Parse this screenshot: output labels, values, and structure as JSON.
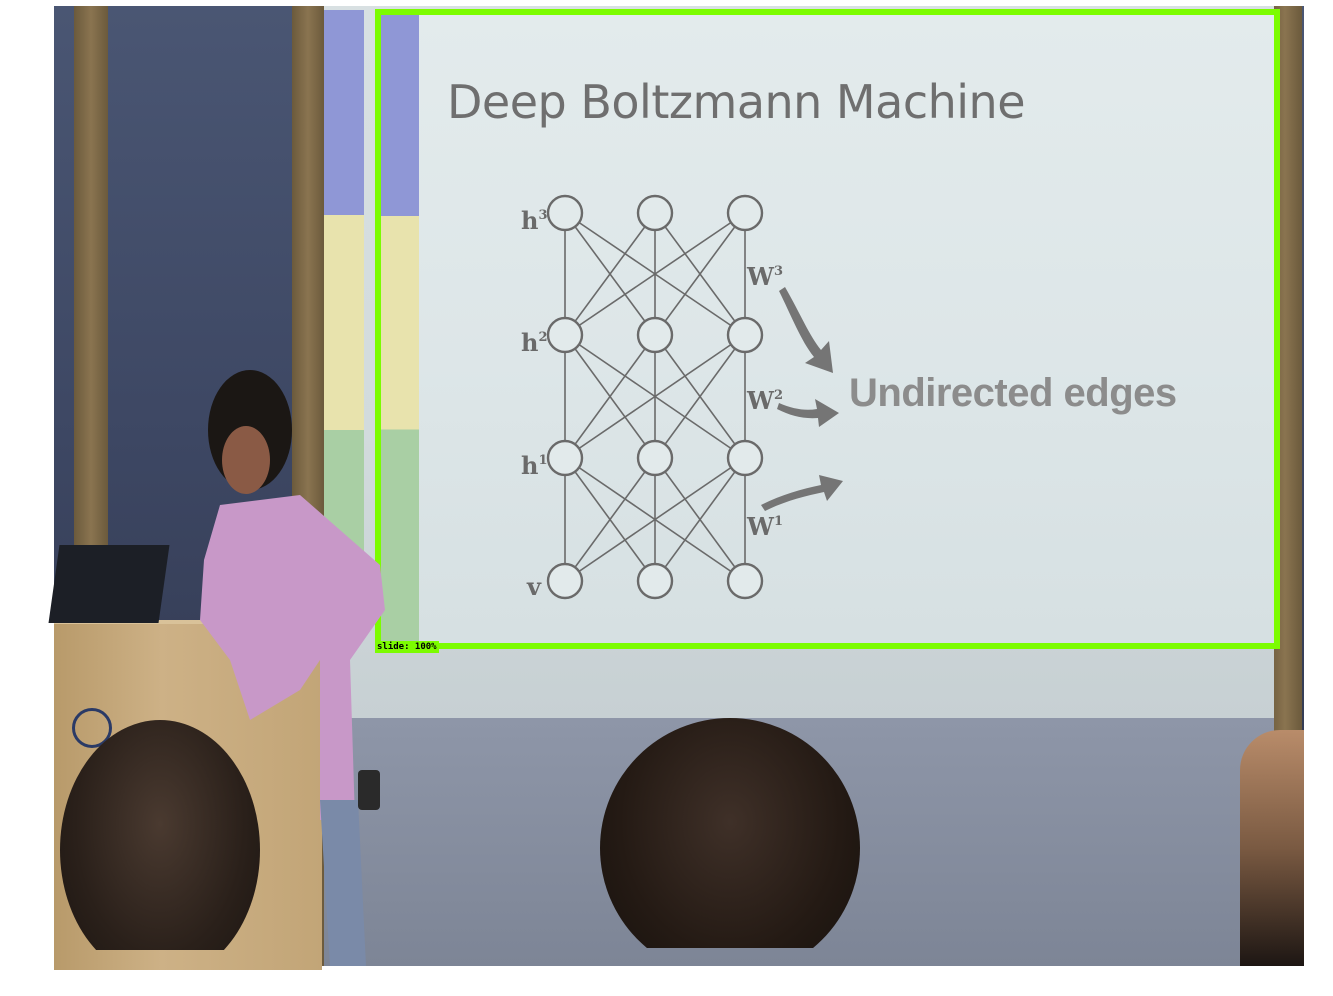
{
  "slide": {
    "title": "Deep Boltzmann Machine",
    "callout": "Undirected edges",
    "layer_labels": [
      "h",
      "h",
      "h",
      "v"
    ],
    "layer_superscripts": [
      "3",
      "2",
      "1",
      ""
    ],
    "weight_labels": [
      "W",
      "W",
      "W"
    ],
    "weight_superscripts": [
      "3",
      "2",
      "1"
    ]
  },
  "detection": {
    "label": "slide: 100%",
    "box_color": "#7cfc00"
  },
  "colors": {
    "slide_text": "#6f6f6f",
    "callout_text": "#8c8c8c",
    "strip_blue": "#8f97d6",
    "strip_yellow": "#e8e3ad",
    "strip_green": "#a9cfa4"
  }
}
